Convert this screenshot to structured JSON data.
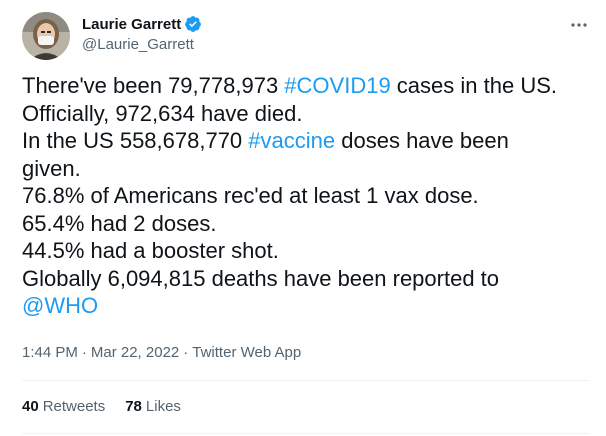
{
  "author": {
    "name": "Laurie Garrett",
    "handle": "@Laurie_Garrett",
    "verified": true,
    "avatar_icon": "profile-photo-masked-person"
  },
  "more_icon": "more-horizontal-icon",
  "tweet": {
    "lines": [
      [
        {
          "text": "There've been 79,778,973 ",
          "link": false
        },
        {
          "text": "#COVID19",
          "link": true
        },
        {
          "text": " cases in the US.",
          "link": false
        }
      ],
      [
        {
          "text": "Officially, 972,634 have died.",
          "link": false
        }
      ],
      [
        {
          "text": "In the US 558,678,770 ",
          "link": false
        },
        {
          "text": "#vaccine",
          "link": true
        },
        {
          "text": " doses have been",
          "link": false
        }
      ],
      [
        {
          "text": "given.",
          "link": false
        }
      ],
      [
        {
          "text": "76.8% of Americans rec'ed at least 1 vax dose.",
          "link": false
        }
      ],
      [
        {
          "text": "65.4% had 2 doses.",
          "link": false
        }
      ],
      [
        {
          "text": "44.5% had a booster shot.",
          "link": false
        }
      ],
      [
        {
          "text": "Globally 6,094,815 deaths have been reported to",
          "link": false
        }
      ],
      [
        {
          "text": "@WHO",
          "link": true
        }
      ]
    ]
  },
  "meta": {
    "time": "1:44 PM",
    "separator": "·",
    "date": "Mar 22, 2022",
    "app": "Twitter Web App"
  },
  "stats": {
    "retweets_count": "40",
    "retweets_label": "Retweets",
    "likes_count": "78",
    "likes_label": "Likes"
  },
  "colors": {
    "link": "#1d9bf0",
    "text": "#0f1419",
    "secondary": "#536471",
    "divider": "#eff3f4"
  }
}
